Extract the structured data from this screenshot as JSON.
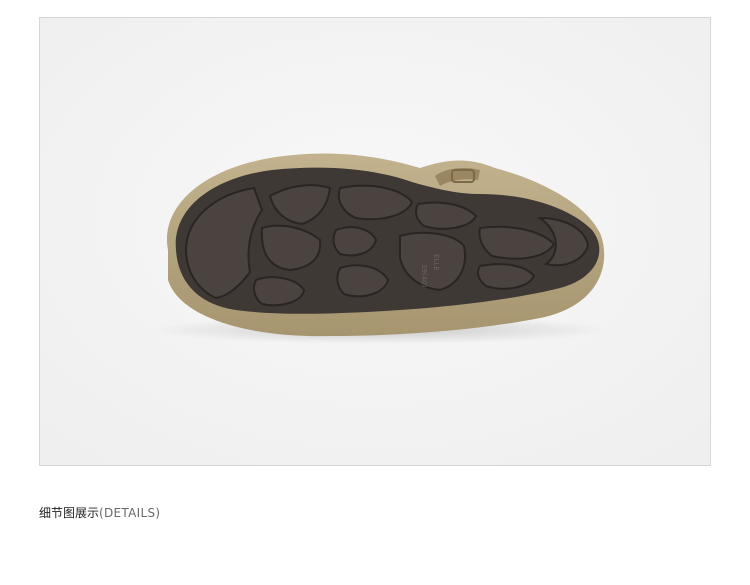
{
  "photo": {
    "alt": "",
    "sole_markings": {
      "size_label": "39(40)",
      "brand_mark": "ELLE"
    }
  },
  "caption": {
    "title": "细节图展示",
    "subtitle": "(DETAILS)"
  },
  "colors": {
    "background": "#f4f4f4",
    "frame_border": "#d6d6d6",
    "suede": "#b2a27c",
    "rubber": "#3f3936",
    "rubber_dark": "#2a2522"
  }
}
